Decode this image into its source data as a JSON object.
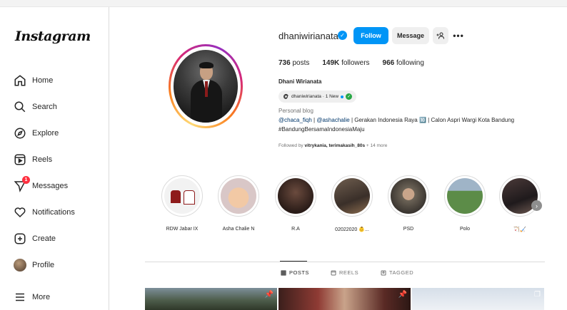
{
  "brand": {
    "logo": "Instagram"
  },
  "sidebar": {
    "items": [
      {
        "label": "Home",
        "icon": "home-icon"
      },
      {
        "label": "Search",
        "icon": "search-icon"
      },
      {
        "label": "Explore",
        "icon": "compass-icon"
      },
      {
        "label": "Reels",
        "icon": "reels-icon"
      },
      {
        "label": "Messages",
        "icon": "messenger-icon",
        "badge": "1"
      },
      {
        "label": "Notifications",
        "icon": "heart-icon"
      },
      {
        "label": "Create",
        "icon": "plus-square-icon"
      },
      {
        "label": "Profile",
        "icon": "avatar"
      },
      {
        "label": "More",
        "icon": "menu-icon"
      }
    ]
  },
  "profile": {
    "username": "dhaniwirianata",
    "follow_label": "Follow",
    "message_label": "Message",
    "stats": {
      "posts_count": "736",
      "posts_label": "posts",
      "followers_count": "149K",
      "followers_label": "followers",
      "following_count": "966",
      "following_label": "following"
    },
    "full_name": "Dhani Wirianata",
    "threads_badge": "dhaniwirianata · 1 New",
    "category": "Personal blog",
    "bio_mention_1": "@chaca_fiqh",
    "bio_sep_1": " | ",
    "bio_mention_2": "@ashachalie",
    "bio_rest": " | Gerakan Indonesia Raya 🔟 | Calon Aspri Wargi Kota Bandung",
    "bio_line2": "#BandungBersamaIndonesiaMaju",
    "followed_by_prefix": "Followed by ",
    "followed_by_names": "vitrykania, terimakasih_80s",
    "followed_by_suffix": " + 14 more"
  },
  "highlights": [
    {
      "label": "RDW Jabar IX"
    },
    {
      "label": "Asha Chalie N"
    },
    {
      "label": "R.A"
    },
    {
      "label": "02022020 👶..."
    },
    {
      "label": "PSD"
    },
    {
      "label": "Polo"
    },
    {
      "label": "🏹🏑"
    }
  ],
  "tabs": [
    {
      "label": "POSTS",
      "icon": "grid-icon",
      "active": true
    },
    {
      "label": "REELS",
      "icon": "reels-tab-icon",
      "active": false
    },
    {
      "label": "TAGGED",
      "icon": "tag-icon",
      "active": false
    }
  ],
  "colors": {
    "accent": "#0095f6",
    "notification_badge": "#ff3040",
    "text": "#262626",
    "muted": "#737373"
  }
}
